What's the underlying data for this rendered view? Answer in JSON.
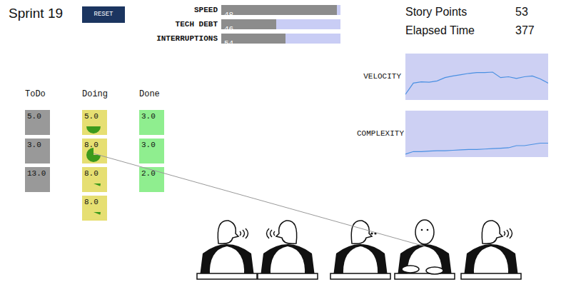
{
  "title": "Sprint 19",
  "reset_button": "RESET",
  "sliders": [
    {
      "label": "SPEED",
      "value": "48",
      "level": 0.97
    },
    {
      "label": "TECH DEBT",
      "value": "46",
      "level": 0.46
    },
    {
      "label": "INTERRUPTIONS",
      "value": "54",
      "level": 0.54
    }
  ],
  "stats": [
    {
      "label": "Story Points",
      "value": "53"
    },
    {
      "label": "Elapsed Time",
      "value": "377"
    }
  ],
  "board": [
    {
      "title": "ToDo",
      "kind": "todo",
      "cards": [
        {
          "points": "5.0"
        },
        {
          "points": "3.0"
        },
        {
          "points": "13.0"
        }
      ]
    },
    {
      "title": "Doing",
      "kind": "doing",
      "cards": [
        {
          "points": "5.0",
          "level": 0.5,
          "assigned": false
        },
        {
          "points": "8.0",
          "level": 0.75,
          "assigned": true
        },
        {
          "points": "8.0",
          "level": 0.06,
          "assigned": false
        },
        {
          "points": "8.0",
          "level": 0.06,
          "assigned": false
        }
      ]
    },
    {
      "title": "Done",
      "kind": "done",
      "cards": [
        {
          "points": "3.0"
        },
        {
          "points": "3.0"
        },
        {
          "points": "2.0"
        }
      ]
    }
  ],
  "charts": [
    {
      "title": "VELOCITY",
      "values": [
        8,
        35,
        38,
        37,
        40,
        48,
        52,
        55,
        58,
        60,
        60,
        61,
        48,
        50,
        46,
        50,
        52,
        45,
        35
      ]
    },
    {
      "title": "COMPLEXITY",
      "values": [
        2,
        8,
        8,
        9,
        10,
        10,
        11,
        12,
        13,
        13,
        14,
        15,
        16,
        17,
        22,
        22,
        25,
        28,
        28
      ]
    }
  ],
  "team": [
    {
      "state": "talking",
      "facing": "right",
      "assigned": false
    },
    {
      "state": "talking",
      "facing": "left",
      "assigned": false
    },
    {
      "state": "thinking",
      "facing": "right",
      "assigned": false
    },
    {
      "state": "working",
      "facing": "front",
      "assigned": true
    },
    {
      "state": "talking",
      "facing": "right",
      "assigned": false
    }
  ]
}
